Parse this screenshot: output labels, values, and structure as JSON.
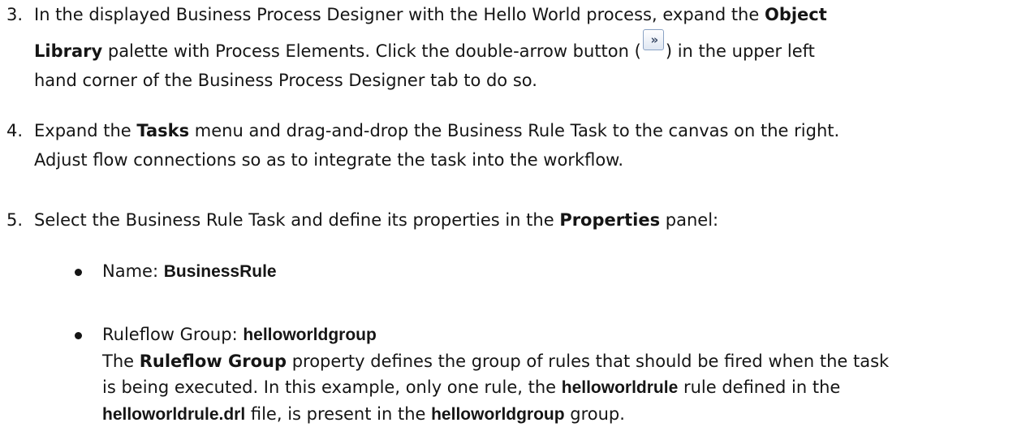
{
  "steps": [
    {
      "number": "3.",
      "t1": "In the displayed Business Process Designer with the Hello World process, expand the ",
      "b1": "Object",
      "b2": "Library",
      "t2": " palette with Process Elements. Click the double-arrow button (",
      "t3": ") in the upper left",
      "t4": "hand corner of the Business Process Designer tab to do so."
    },
    {
      "number": "4.",
      "t1": "Expand the ",
      "b1": "Tasks",
      "t2": " menu and drag-and-drop the Business Rule Task to the canvas on the right.",
      "t3": "Adjust flow connections so as to integrate the task into the workflow."
    },
    {
      "number": "5.",
      "t1": "Select the Business Rule Task and define its properties in the ",
      "b1": "Properties",
      "t2": " panel:"
    }
  ],
  "icons": {
    "double_arrow_button": "double-arrow-icon",
    "glyph": "»"
  },
  "bullets": [
    {
      "label": "Name",
      "sep": ": ",
      "value": "BusinessRule"
    },
    {
      "label": "Ruleflow Group",
      "sep": ": ",
      "value": "helloworldgroup",
      "desc_t1": "The ",
      "desc_b1": "Ruleflow Group",
      "desc_t2": " property defines the group of rules that should be fired when the task",
      "desc_t3": "is being executed. In this example, only one rule, the ",
      "desc_b2": "helloworldrule",
      "desc_t4": " rule defined in the",
      "desc_b3": "helloworldrule.drl",
      "desc_t5": " file, is present in the ",
      "desc_b4": "helloworldgroup",
      "desc_t6": " group."
    }
  ]
}
